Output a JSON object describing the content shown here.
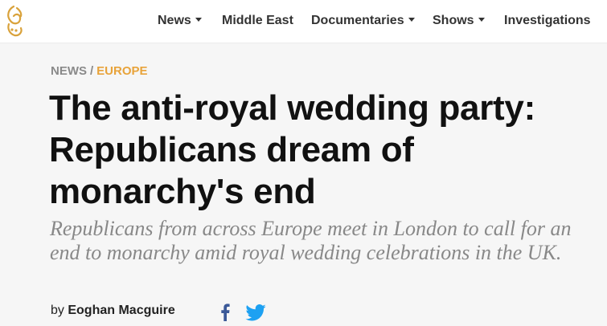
{
  "header": {
    "logo_icon": "al-jazeera-logo-icon",
    "nav": [
      {
        "label": "News",
        "has_dropdown": true
      },
      {
        "label": "Middle East",
        "has_dropdown": false
      },
      {
        "label": "Documentaries",
        "has_dropdown": true
      },
      {
        "label": "Shows",
        "has_dropdown": true
      },
      {
        "label": "Investigations",
        "has_dropdown": false
      }
    ]
  },
  "breadcrumb": {
    "section": "NEWS",
    "separator": "/",
    "topic": "EUROPE",
    "topic_color": "#e8a33a"
  },
  "article": {
    "headline": "The anti-royal wedding party: Republicans dream of monarchy's end",
    "standfirst": "Republicans from across Europe meet in London to call for an end to monarchy amid royal wedding celebrations in the UK.",
    "byline_prefix": "by",
    "author": "Eoghan Macguire"
  },
  "share": {
    "facebook_icon": "facebook-icon",
    "facebook_color": "#3b5998",
    "twitter_icon": "twitter-icon",
    "twitter_color": "#1da1f2"
  }
}
